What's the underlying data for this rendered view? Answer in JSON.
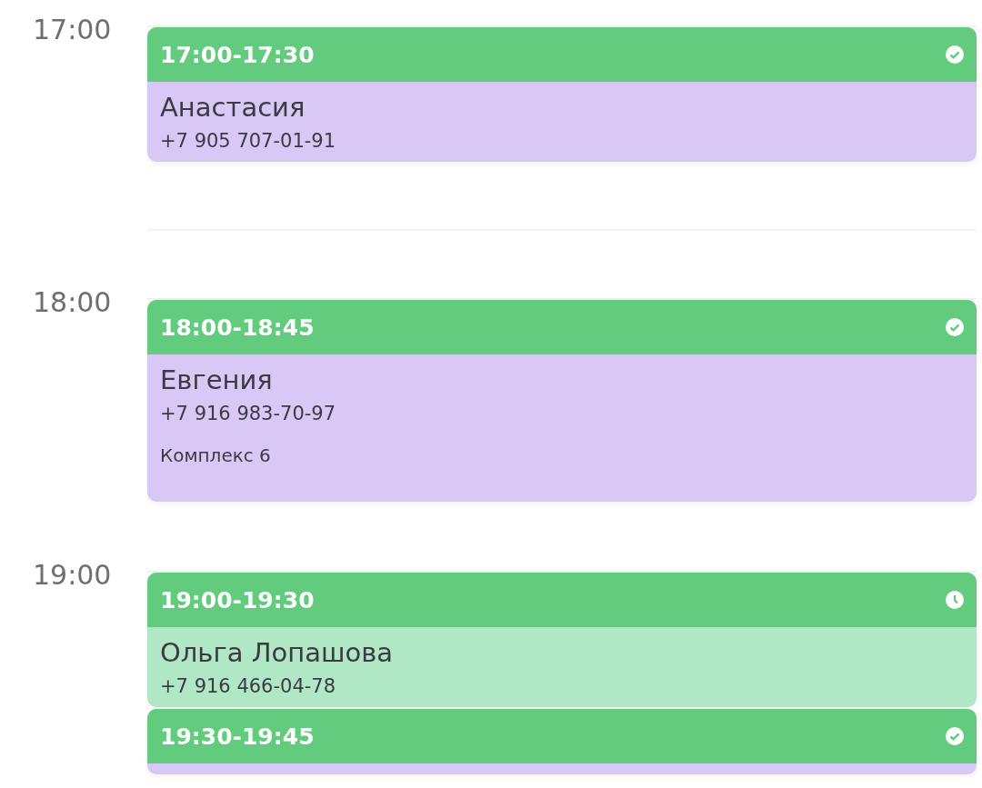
{
  "hours": [
    {
      "label": "17:00",
      "events": [
        {
          "time": "17:00-17:30",
          "kind": "confirmed",
          "name": "Анастасия",
          "phone": "+7 905 707-01-91"
        }
      ]
    },
    {
      "label": "18:00",
      "events": [
        {
          "time": "18:00-18:45",
          "kind": "confirmed",
          "name": "Евгения",
          "phone": "+7 916 983-70-97",
          "note": "Комплекс 6"
        }
      ]
    },
    {
      "label": "19:00",
      "events": [
        {
          "time": "19:00-19:30",
          "kind": "pending",
          "name": "Ольга Лопашова",
          "phone": "+7 916 466-04-78"
        },
        {
          "time": "19:30-19:45",
          "kind": "confirmed"
        }
      ]
    }
  ]
}
